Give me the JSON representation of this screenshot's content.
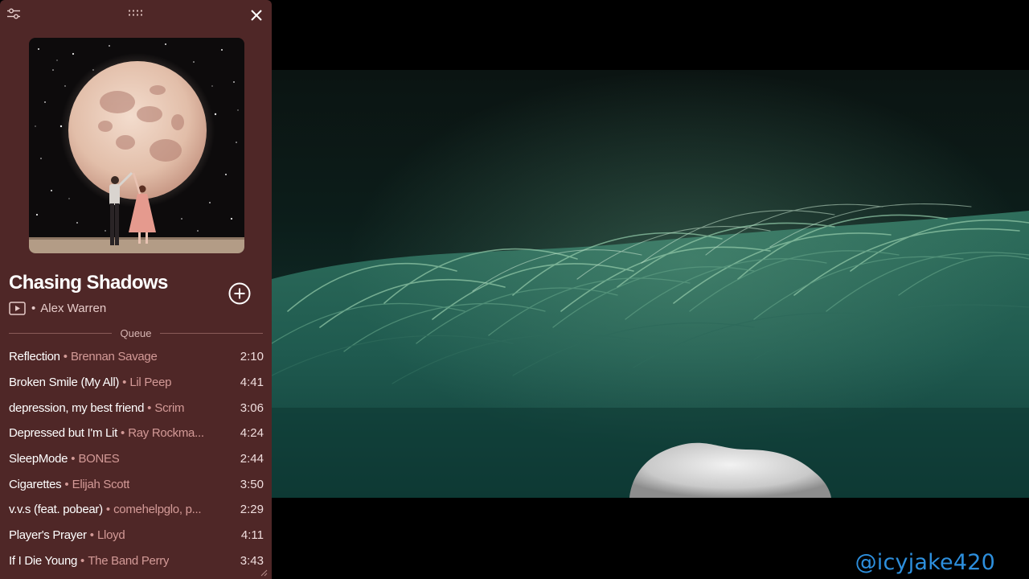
{
  "player": {
    "track_title": "Chasing Shadows",
    "artist": "Alex Warren",
    "separator": "•",
    "queue_label": "Queue",
    "icons": {
      "settings": "sliders-icon",
      "grip": "drag-handle-icon",
      "close": "close-icon",
      "add": "add-circle-icon",
      "video": "video-play-icon",
      "resize": "resize-grip-icon"
    },
    "colors": {
      "panel_bg": "#4f2727",
      "artist_accent": "#d39a97"
    },
    "queue": [
      {
        "title": "Reflection",
        "artist": "Brennan Savage",
        "duration": "2:10"
      },
      {
        "title": "Broken Smile (My All)",
        "artist": "Lil Peep",
        "duration": "4:41"
      },
      {
        "title": "depression, my best friend",
        "artist": "Scrim",
        "duration": "3:06"
      },
      {
        "title": "Depressed but I'm Lit",
        "artist": "Ray Rockma...",
        "duration": "4:24"
      },
      {
        "title": "SleepMode",
        "artist": "BONES",
        "duration": "2:44"
      },
      {
        "title": "Cigarettes",
        "artist": "Elijah Scott",
        "duration": "3:50"
      },
      {
        "title": "v.v.s (feat. pobear)",
        "artist": "comehelpglo, p...",
        "duration": "2:29"
      },
      {
        "title": "Player's Prayer",
        "artist": "Lloyd",
        "duration": "4:11"
      },
      {
        "title": "If I Die Young",
        "artist": "The Band Perry",
        "duration": "3:43"
      }
    ]
  },
  "overlay": {
    "watermark": "@icyjake420",
    "watermark_color": "#2d8fdd"
  }
}
